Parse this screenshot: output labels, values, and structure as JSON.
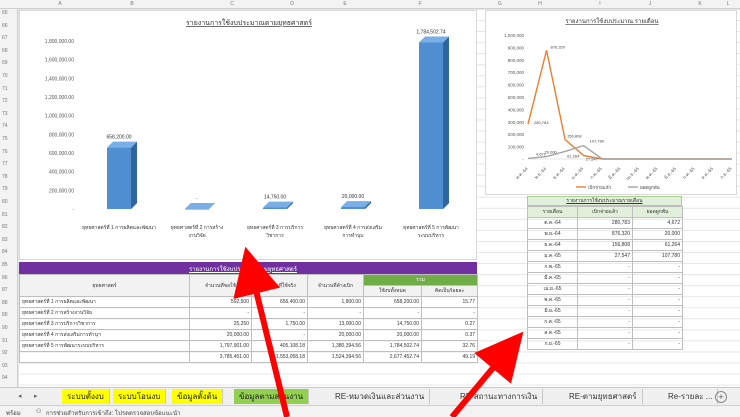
{
  "columns": [
    "A",
    "B",
    "C",
    "D",
    "E",
    "F",
    "G",
    "H",
    "I",
    "J",
    "K",
    "L"
  ],
  "rows": [
    "65",
    "66",
    "67",
    "68",
    "69",
    "70",
    "71",
    "72",
    "73",
    "74",
    "75",
    "76",
    "77",
    "78",
    "79",
    "80",
    "81",
    "82",
    "83",
    "84",
    "85",
    "86",
    "87",
    "88",
    "89",
    "90",
    "91",
    "92",
    "93",
    "94"
  ],
  "chart1": {
    "title": "รายงานการใช้งบประมาณตามยุทธศาสตร์",
    "y_ticks": [
      "1,800,000.00",
      "1,600,000.00",
      "1,400,000.00",
      "1,200,000.00",
      "1,000,000.00",
      "800,000.00",
      "600,000.00",
      "400,000.00",
      "200,000.00",
      "-"
    ],
    "bars": [
      {
        "label1": "ยุทธศาสตร์ที่ 1 การผลิตและพัฒนา",
        "label2": "",
        "value": 658200,
        "value_label": "658,200.00"
      },
      {
        "label1": "ยุทธศาสตร์ที่ 2 การสร้าง",
        "label2": "งานวิจัย",
        "value": 0,
        "value_label": "-"
      },
      {
        "label1": "ยุทธศาสตร์ที่ 3 การบริการ",
        "label2": "วิชาการ",
        "value": 14750,
        "value_label": "14,750.00"
      },
      {
        "label1": "ยุทธศาสตร์ที่ 4 การส่งเสริม",
        "label2": "การทำนุบ",
        "value": 20000,
        "value_label": "20,000.00"
      },
      {
        "label1": "ยุทธศาสตร์ที่ 5 การพัฒนา",
        "label2": "ระบบบริหาร",
        "value": 1784502.74,
        "value_label": "1,784,502.74"
      }
    ]
  },
  "chart2": {
    "title": "รายงานการใช้งบประมาณ รายเดือน",
    "y_ticks": [
      "1,000,000",
      "900,000",
      "800,000",
      "700,000",
      "600,000",
      "500,000",
      "400,000",
      "300,000",
      "200,000",
      "100,000",
      "-"
    ],
    "months": [
      "ต.ค.-64",
      "พ.ย.-64",
      "ธ.ค.-64",
      "ม.ค.-65",
      "ก.พ.-65",
      "มี.ค.-65",
      "เม.ย.-65",
      "พ.ค.-65",
      "มิ.ย.-65",
      "ก.ค.-65",
      "ส.ค.-65",
      "ก.ย.-65"
    ],
    "series": [
      {
        "name": "เบิกจ่ายแล้ว",
        "color": "#ed7d31",
        "values": [
          280783,
          876320,
          156808,
          27547,
          0,
          0,
          0,
          0,
          0,
          0,
          0,
          0
        ]
      },
      {
        "name": "ยอดผูกพัน",
        "color": "#a5a5a5",
        "values": [
          4672,
          20000,
          61264,
          107780,
          0,
          0,
          0,
          0,
          0,
          0,
          0,
          0
        ]
      }
    ],
    "point_labels": [
      "280,783",
      "876,320",
      "156,808",
      "27,547",
      "107,780",
      "61,264",
      "20,000",
      "4,672"
    ]
  },
  "table1": {
    "title": "รายงานการใช้งบประมาณตามยุทธศาสตร์",
    "headers": [
      "ยุทธศาสตร์",
      "จำนวนที่ขอใช้",
      "จำนวนที่ใช้จริง",
      "จำนวนที่ค้างเบิก",
      "รวม",
      "ใช้งบทั้งหมด",
      "คิดเป็นร้อยละ"
    ],
    "rows": [
      [
        "ยุทธศาสตร์ที่ 1 การผลิตและพัฒนา",
        "592,500",
        "656,400.00",
        "1,800.00",
        "658,200.00",
        "15.77"
      ],
      [
        "ยุทธศาสตร์ที่ 2 การสร้างงานวิจัย",
        "-",
        "-",
        "-",
        "-",
        "-"
      ],
      [
        "ยุทธศาสตร์ที่ 3 การบริการวิชาการ",
        "25,250",
        "1,750.00",
        "13,000.00",
        "14,750.00",
        "0.27"
      ],
      [
        "ยุทธศาสตร์ที่ 4 การส่งเสริมการทำนุฯ",
        "20,000.00",
        "-",
        "20,000.00",
        "20,000.00",
        "0.37"
      ],
      [
        "ยุทธศาสตร์ที่ 5 การพัฒนาระบบบริหาร",
        "1,797,901.00",
        "405,108.18",
        "1,380,394.56",
        "1,784,502.74",
        "32.76"
      ],
      [
        "",
        "3,785,451.00",
        "1,553,058.18",
        "1,524,394.56",
        "2,677,452.74",
        "49.19"
      ]
    ]
  },
  "table2": {
    "title": "รายงานการใช้งบประมาณรายเดือน",
    "headers": [
      "รายเดือน",
      "เบิกจ่ายแล้ว",
      "ยอดผูกพัน"
    ],
    "rows": [
      [
        "ต.ค.-64",
        "280,783",
        "4,672"
      ],
      [
        "พ.ย.-64",
        "876,320",
        "20,000"
      ],
      [
        "ธ.ค.-64",
        "156,808",
        "61,264"
      ],
      [
        "ม.ค.-65",
        "27,547",
        "107,780"
      ],
      [
        "ก.พ.-65",
        "-",
        "-"
      ],
      [
        "มี.ค.-65",
        "-",
        "-"
      ],
      [
        "เม.ย.-65",
        "-",
        "-"
      ],
      [
        "พ.ค.-65",
        "-",
        "-"
      ],
      [
        "มิ.ย.-65",
        "-",
        "-"
      ],
      [
        "ก.ค.-65",
        "-",
        "-"
      ],
      [
        "ส.ค.-65",
        "-",
        "-"
      ],
      [
        "ก.ย.-65",
        "-",
        "-"
      ]
    ]
  },
  "tabs": [
    {
      "label": "ระบบตั้งงบ",
      "style": "yellow"
    },
    {
      "label": "ระบบโอนงบ",
      "style": "yellow"
    },
    {
      "label": "ข้อมูลตั้งต้น",
      "style": "yellow"
    },
    {
      "label": "ข้อมูลตามส่วนงาน",
      "style": "green"
    },
    {
      "label": "RE-หมวดเงินและส่วนงาน",
      "style": "plain"
    },
    {
      "label": "RE-สถานะทางการเงิน",
      "style": "plain"
    },
    {
      "label": "RE-ตามยุทธศาสตร์",
      "style": "plain"
    },
    {
      "label": "Re-รายละ ...",
      "style": "plain"
    }
  ],
  "tabnav": {
    "prev": "◂",
    "next": "▸",
    "add": "+"
  },
  "status": {
    "ready": "พร้อม",
    "accessibility": "การช่วยสำหรับการเข้าถึง: โปรดตรวจสอบข้อแนะนำ"
  }
}
